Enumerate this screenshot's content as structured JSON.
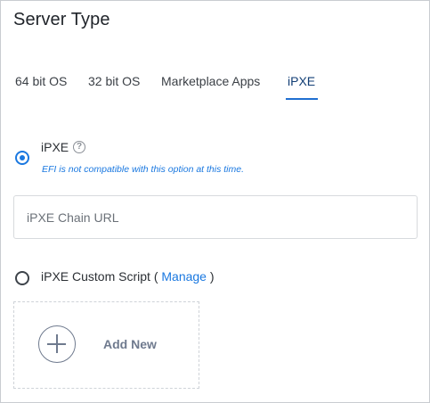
{
  "panel": {
    "title": "Server Type"
  },
  "tabs": [
    {
      "label": "64 bit OS",
      "active": false
    },
    {
      "label": "32 bit OS",
      "active": false
    },
    {
      "label": "Marketplace Apps",
      "active": false
    },
    {
      "label": "iPXE",
      "active": true
    }
  ],
  "ipxe_option": {
    "label": "iPXE",
    "help_icon": "question-circle-icon",
    "help_glyph": "?",
    "note": "EFI is not compatible with this option at this time.",
    "selected": true
  },
  "chain_url": {
    "placeholder": "iPXE Chain URL",
    "value": ""
  },
  "custom_script_option": {
    "label_prefix": "iPXE Custom Script (",
    "manage_link": "Manage",
    "label_suffix": ")",
    "selected": false
  },
  "add_new": {
    "label": "Add New",
    "icon": "plus-circle-icon"
  },
  "colors": {
    "accent": "#1a78e0",
    "tab_active": "#123e75",
    "muted_icon": "#6f7a8e"
  }
}
